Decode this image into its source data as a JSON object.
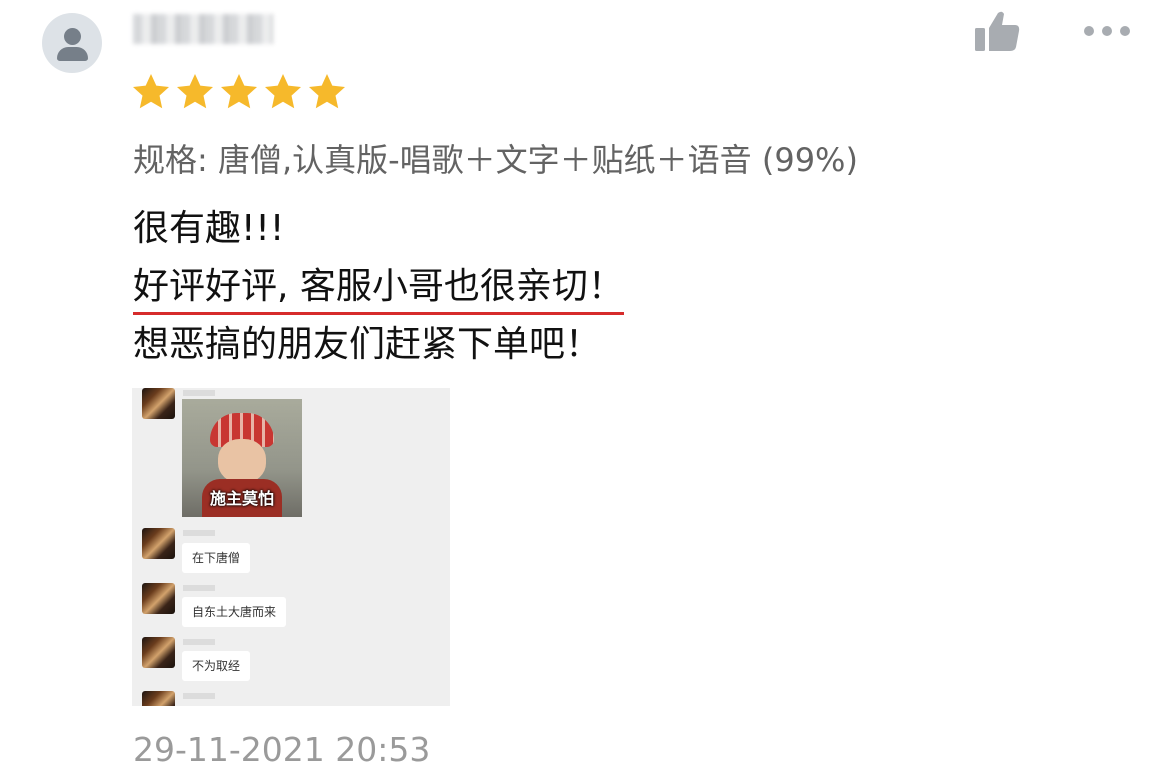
{
  "review": {
    "username": "",
    "rating": 5,
    "spec": "规格: 唐僧,认真版-唱歌＋文字＋贴纸＋语音 (99%)",
    "text_lines": [
      "很有趣!!!",
      "好评好评, 客服小哥也很亲切！",
      "想恶搞的朋友们赶紧下单吧！"
    ],
    "date": "29-11-2021 20:53",
    "colors": {
      "star": "#f6b92b",
      "underline": "#d62b2b"
    }
  },
  "photo": {
    "sticker_caption": "施主莫怕",
    "messages": [
      "在下唐僧",
      "自东土大唐而来",
      "不为取经"
    ]
  },
  "icons": [
    "avatar",
    "thumbs-up-icon",
    "more-options-icon",
    "star-icon"
  ]
}
